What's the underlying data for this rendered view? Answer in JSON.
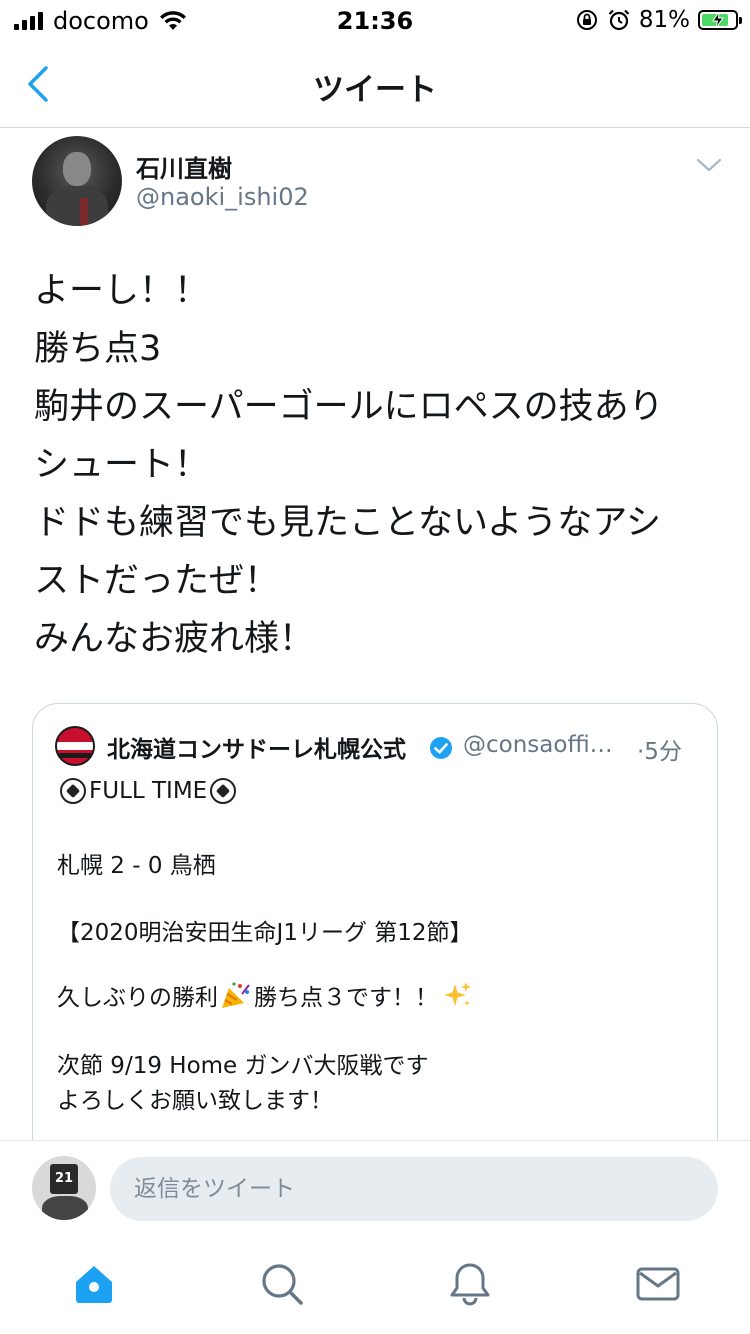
{
  "status_bar": {
    "carrier": "docomo",
    "time": "21:36",
    "battery_percent": "81%",
    "battery_level": 0.81,
    "icons": [
      "signal-icon",
      "wifi-icon",
      "orientation-lock-icon",
      "alarm-icon",
      "battery-charging-icon"
    ]
  },
  "nav": {
    "title": "ツイート",
    "back_icon": "chevron-left-icon"
  },
  "tweet": {
    "author_name": "石川直樹",
    "author_handle": "@naoki_ishi02",
    "lines": [
      "よーし！！",
      "勝ち点3",
      "駒井のスーパーゴールにロペスの技あり",
      "シュート！",
      "ドドも練習でも見たことないようなアシ",
      "ストだったぜ！",
      "みんなお疲れ様！"
    ]
  },
  "quoted_tweet": {
    "account_name": "北海道コンサドーレ札幌公式",
    "handle": "@consaoffi…",
    "time": "·5分",
    "verified": true,
    "full_time_text": "FULL TIME",
    "score": "札幌 2 - 0 鳥栖",
    "league": "【2020明治安田生命J1リーグ 第12節】",
    "victory_before": "久しぶりの勝利",
    "victory_after": "勝ち点３です！！",
    "next_match": "次節 9/19 Home ガンバ大阪戦です",
    "closing": "よろしくお願い致します！"
  },
  "reply": {
    "placeholder": "返信をツイート",
    "value": ""
  },
  "tab_bar": {
    "tabs": [
      "home-icon",
      "search-icon",
      "notifications-icon",
      "messages-icon"
    ],
    "active": "home-icon"
  },
  "colors": {
    "accent": "#1da1f2",
    "tab_active": "#1da1f2",
    "tab_inactive": "#657786",
    "secondary_text": "#657786",
    "battery_fill": "#4cd964"
  }
}
